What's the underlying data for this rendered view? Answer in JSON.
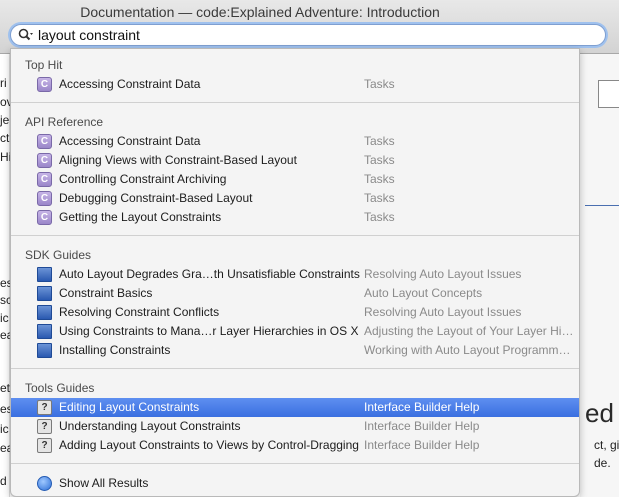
{
  "window": {
    "title": "Documentation — code:Explained Adventure: Introduction"
  },
  "search": {
    "value": "layout constraint"
  },
  "background": {
    "left_fragments": [
      "ri",
      "ov",
      "je",
      "ct",
      "Hi",
      "es",
      "sc",
      "ic",
      "ea",
      "ets",
      "es",
      "ic",
      "ea",
      "d"
    ],
    "right_heading": "ed",
    "right_text": [
      "ct, givi",
      "de."
    ]
  },
  "sections": [
    {
      "header": "Top Hit",
      "items": [
        {
          "icon": "class-icon",
          "icon_glyph": "C",
          "label": "Accessing Constraint Data",
          "sub": "Tasks"
        }
      ]
    },
    {
      "header": "API Reference",
      "items": [
        {
          "icon": "class-icon",
          "icon_glyph": "C",
          "label": "Accessing Constraint Data",
          "sub": "Tasks"
        },
        {
          "icon": "class-icon",
          "icon_glyph": "C",
          "label": "Aligning Views with Constraint-Based Layout",
          "sub": "Tasks"
        },
        {
          "icon": "class-icon",
          "icon_glyph": "C",
          "label": "Controlling Constraint Archiving",
          "sub": "Tasks"
        },
        {
          "icon": "class-icon",
          "icon_glyph": "C",
          "label": "Debugging Constraint-Based Layout",
          "sub": "Tasks"
        },
        {
          "icon": "class-icon",
          "icon_glyph": "C",
          "label": "Getting the Layout Constraints",
          "sub": "Tasks"
        }
      ]
    },
    {
      "header": "SDK Guides",
      "items": [
        {
          "icon": "guide-book-icon",
          "icon_glyph": "",
          "label": "Auto Layout Degrades Gra…th Unsatisfiable Constraints",
          "sub": "Resolving Auto Layout Issues"
        },
        {
          "icon": "guide-book-icon",
          "icon_glyph": "",
          "label": "Constraint Basics",
          "sub": "Auto Layout Concepts"
        },
        {
          "icon": "guide-book-icon",
          "icon_glyph": "",
          "label": "Resolving Constraint Conflicts",
          "sub": "Resolving Auto Layout Issues"
        },
        {
          "icon": "guide-book-icon",
          "icon_glyph": "",
          "label": "Using Constraints to Mana…r Layer Hierarchies in OS X",
          "sub": "Adjusting the Layout of Your Layer Hi…"
        },
        {
          "icon": "guide-book-icon",
          "icon_glyph": "",
          "label": "Installing Constraints",
          "sub": "Working with Auto Layout Programm…"
        }
      ]
    },
    {
      "header": "Tools Guides",
      "items": [
        {
          "icon": "help-icon",
          "icon_glyph": "?",
          "label": "Editing Layout Constraints",
          "sub": "Interface Builder Help",
          "selected": true
        },
        {
          "icon": "help-icon",
          "icon_glyph": "?",
          "label": "Understanding Layout Constraints",
          "sub": "Interface Builder Help"
        },
        {
          "icon": "help-icon",
          "icon_glyph": "?",
          "label": "Adding Layout Constraints to Views by Control-Dragging",
          "sub": "Interface Builder Help"
        }
      ]
    }
  ],
  "footer": {
    "label": "Show All Results",
    "icon": "search-all-icon"
  },
  "colors": {
    "selection": "#3a6fe0",
    "class_icon": "#9a86c9",
    "guide_icon": "#2a59b0"
  }
}
